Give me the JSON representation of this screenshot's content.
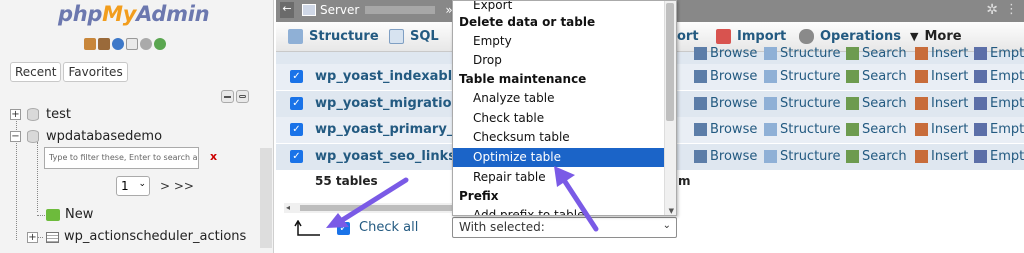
{
  "logo": {
    "php": "php",
    "my": "My",
    "admin": "Admin"
  },
  "nav": {
    "tabs": [
      "Recent",
      "Favorites"
    ],
    "databases": [
      {
        "name": "test",
        "expand": "+"
      },
      {
        "name": "wpdatabasedemo",
        "expand": "−"
      }
    ],
    "filter_placeholder": "Type to filter these, Enter to search all",
    "filter_clear": "x",
    "page": "1",
    "page_chevron": "⌄",
    "next": "> >>",
    "new_label": "New",
    "first_table": "wp_actionscheduler_actions",
    "first_table_expand": "+"
  },
  "topbar": {
    "back": "←",
    "server": "Server",
    "sep": "»",
    "gear": "✲",
    "menu": "⋮"
  },
  "menu": {
    "structure": "Structure",
    "sql": "SQL",
    "export_tail": "ort",
    "import": "Import",
    "operations": "Operations",
    "more": "More",
    "more_arrow": "▼"
  },
  "tables": [
    {
      "name": "wp_yoast_indexable_h"
    },
    {
      "name": "wp_yoast_migrations"
    },
    {
      "name": "wp_yoast_primary_terr"
    },
    {
      "name": "wp_yoast_seo_links"
    }
  ],
  "row_actions": {
    "browse": "Browse",
    "structure": "Structure",
    "search": "Search",
    "insert": "Insert",
    "empty": "Empt"
  },
  "check": "✓",
  "summary": "55 tables",
  "summary_tail": "m",
  "check_all": "Check all",
  "with_selected": "With selected:",
  "with_selected_chevron": "⌄",
  "dropdown": {
    "items": [
      {
        "label": "Export",
        "group": false,
        "selected": false
      },
      {
        "label": "Delete data or table",
        "group": true,
        "selected": false
      },
      {
        "label": "Empty",
        "group": false,
        "selected": false
      },
      {
        "label": "Drop",
        "group": false,
        "selected": false
      },
      {
        "label": "Table maintenance",
        "group": true,
        "selected": false
      },
      {
        "label": "Analyze table",
        "group": false,
        "selected": false
      },
      {
        "label": "Check table",
        "group": false,
        "selected": false
      },
      {
        "label": "Checksum table",
        "group": false,
        "selected": false
      },
      {
        "label": "Optimize table",
        "group": false,
        "selected": true
      },
      {
        "label": "Repair table",
        "group": false,
        "selected": false
      },
      {
        "label": "Prefix",
        "group": true,
        "selected": false
      },
      {
        "label": "Add prefix to table",
        "group": false,
        "selected": false
      }
    ]
  },
  "colors": {
    "link": "#235a81",
    "selected": "#1b64c8",
    "arrow": "#7a5ae6",
    "checkbox": "#1a73e8"
  }
}
